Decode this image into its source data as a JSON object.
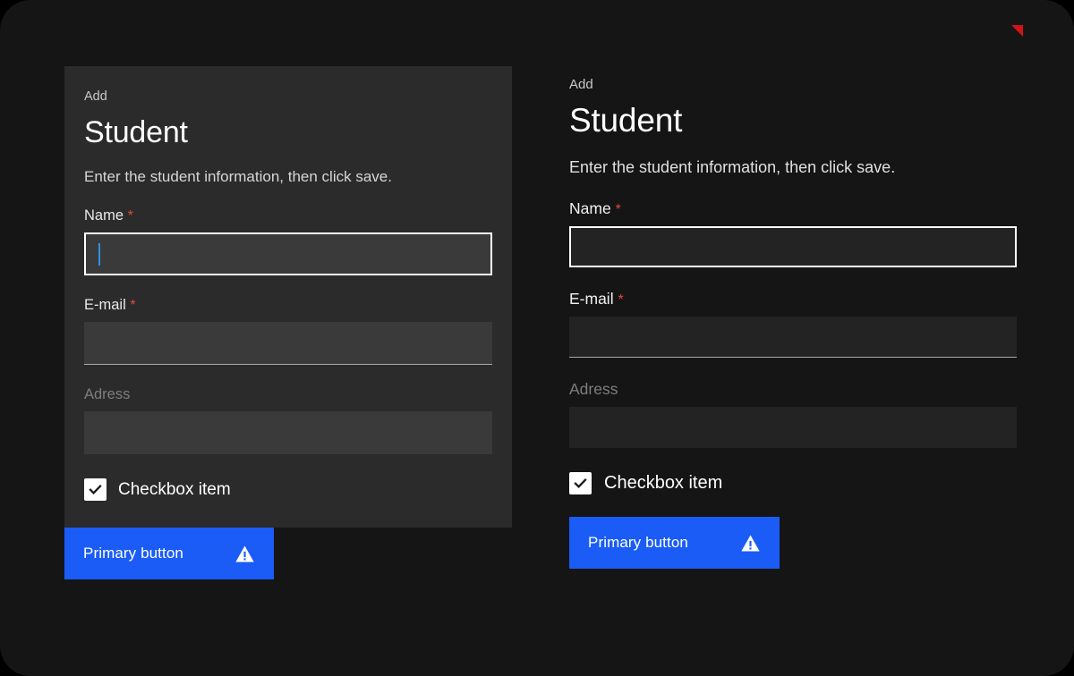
{
  "canvas": {
    "background_color": "#000000",
    "stage_color": "#151515",
    "corner_marker_color": "#d01414",
    "accent_color": "#1a5cf5",
    "required_color": "#e2493f",
    "card_surface_color": "#2b2b2b"
  },
  "form": {
    "eyebrow": "Add",
    "title": "Student",
    "subtitle": "Enter the student information, then click save.",
    "fields": [
      {
        "label": "Name",
        "required_marker": "*",
        "required": true,
        "value": "",
        "placeholder": "",
        "state": "focused",
        "caret_visible": true
      },
      {
        "label": "E-mail",
        "required_marker": "*",
        "required": true,
        "value": "",
        "placeholder": "",
        "state": "underline",
        "caret_visible": false
      },
      {
        "label": "Adress",
        "required_marker": "",
        "required": false,
        "value": "",
        "placeholder": "",
        "state": "disabled",
        "caret_visible": false
      }
    ],
    "checkbox": {
      "label": "Checkbox item",
      "checked": true
    },
    "primary_button": {
      "label": "Primary button",
      "icon": "warning-triangle-icon"
    }
  },
  "variants": [
    {
      "name": "card-surface-variant"
    },
    {
      "name": "plain-background-variant"
    }
  ]
}
